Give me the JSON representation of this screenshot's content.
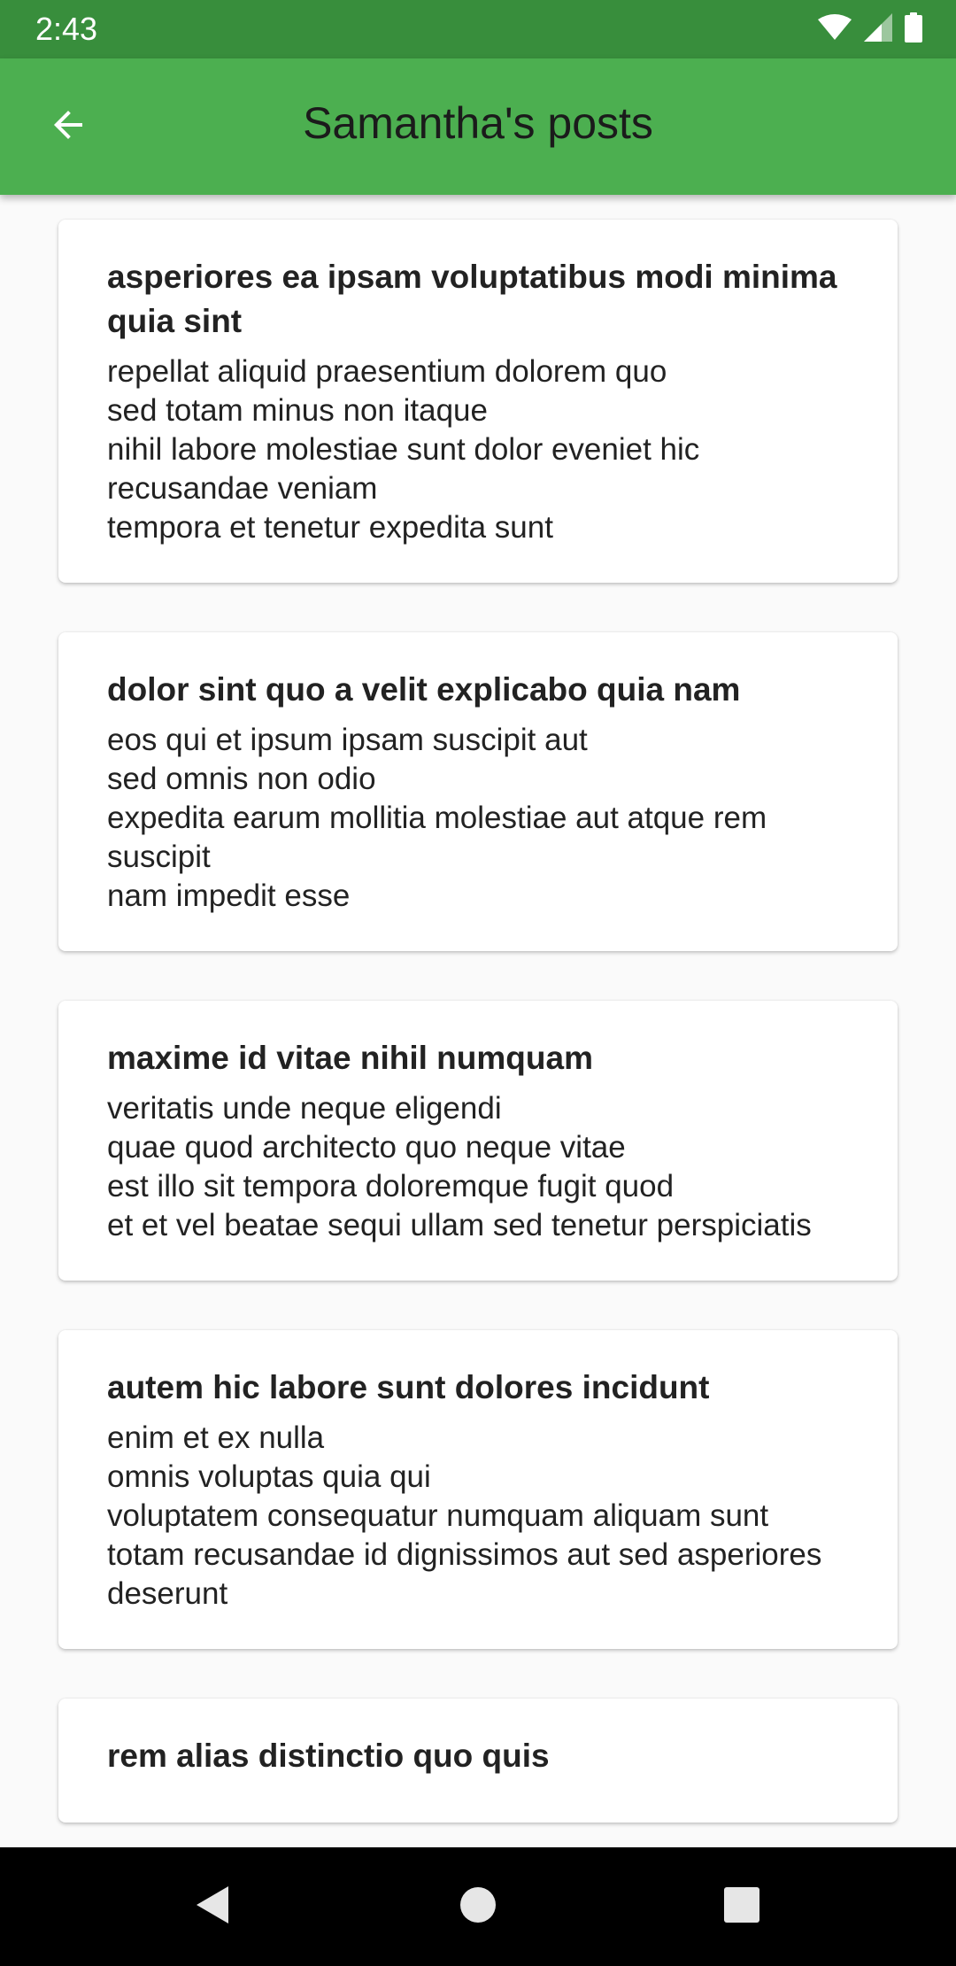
{
  "status_bar": {
    "time": "2:43",
    "icons": [
      "wifi-icon",
      "cell-signal-icon",
      "battery-icon"
    ]
  },
  "app_bar": {
    "title": "Samantha's posts",
    "back_icon": "arrow-back-icon",
    "background_color": "#4caf50"
  },
  "posts": [
    {
      "title": "asperiores ea ipsam voluptatibus modi minima quia sint",
      "body": "repellat aliquid praesentium dolorem quo\nsed totam minus non itaque\nnihil labore molestiae sunt dolor eveniet hic recusandae veniam\ntempora et tenetur expedita sunt"
    },
    {
      "title": "dolor sint quo a velit explicabo quia nam",
      "body": "eos qui et ipsum ipsam suscipit aut\nsed omnis non odio\nexpedita earum mollitia molestiae aut atque rem suscipit\nnam impedit esse"
    },
    {
      "title": "maxime id vitae nihil numquam",
      "body": "veritatis unde neque eligendi\nquae quod architecto quo neque vitae\nest illo sit tempora doloremque fugit quod\net et vel beatae sequi ullam sed tenetur perspiciatis"
    },
    {
      "title": "autem hic labore sunt dolores incidunt",
      "body": "enim et ex nulla\nomnis voluptas quia qui\nvoluptatem consequatur numquam aliquam sunt\ntotam recusandae id dignissimos aut sed asperiores deserunt"
    },
    {
      "title": "rem alias distinctio quo quis",
      "body": ""
    }
  ],
  "nav_bar": {
    "buttons": [
      "back-triangle-icon",
      "home-circle-icon",
      "recents-square-icon"
    ]
  }
}
